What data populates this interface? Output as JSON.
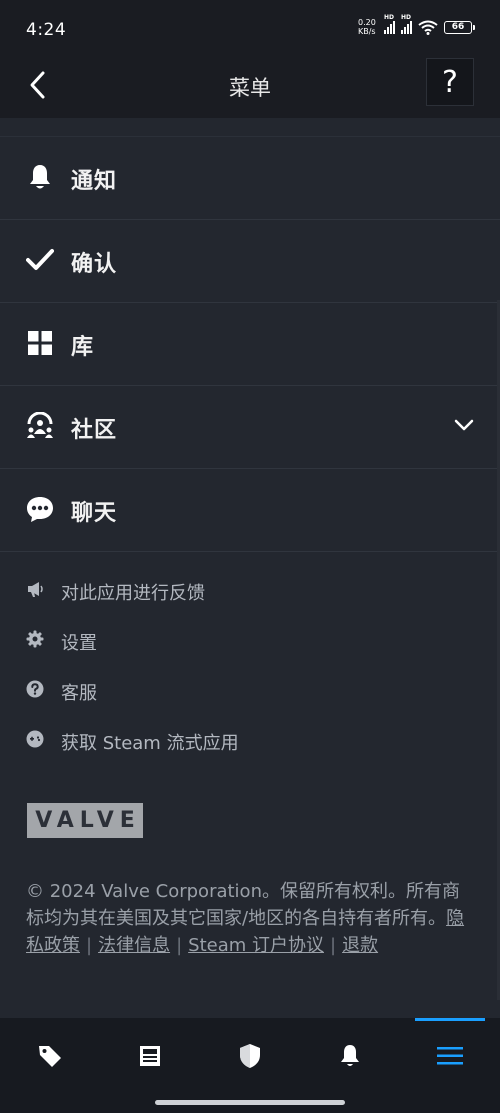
{
  "status_bar": {
    "time": "4:24",
    "net_speed_value": "0.20",
    "net_speed_unit": "KB/s",
    "signal1_label": "HD",
    "signal2_label": "HD",
    "battery": "66"
  },
  "header": {
    "title": "菜单",
    "help_label": "?"
  },
  "menu": {
    "items": [
      {
        "label": "通知",
        "icon": "bell-icon"
      },
      {
        "label": "确认",
        "icon": "checkmark-icon"
      },
      {
        "label": "库",
        "icon": "library-grid-icon"
      },
      {
        "label": "社区",
        "icon": "community-icon",
        "expandable": true
      },
      {
        "label": "聊天",
        "icon": "chat-bubble-icon"
      }
    ]
  },
  "links": {
    "items": [
      {
        "label": "对此应用进行反馈",
        "icon": "megaphone-icon"
      },
      {
        "label": "设置",
        "icon": "gear-icon"
      },
      {
        "label": "客服",
        "icon": "question-circle-icon"
      },
      {
        "label": "获取 Steam 流式应用",
        "icon": "gamepad-icon"
      }
    ]
  },
  "logo": {
    "text": "VALVE"
  },
  "legal": {
    "copyright": "© 2024 Valve Corporation。保留所有权利。所有商标均为其在美国及其它国家/地区的各自持有者所有。",
    "privacy": "隐私政策",
    "legal_info": "法律信息",
    "subscriber_agreement": "Steam 订户协议",
    "logout": "退款",
    "separator": "|"
  },
  "bottom_nav": {
    "items": [
      {
        "icon": "tag-icon",
        "name": "store"
      },
      {
        "icon": "news-icon",
        "name": "news"
      },
      {
        "icon": "shield-icon",
        "name": "guard"
      },
      {
        "icon": "bell-icon",
        "name": "notifications"
      },
      {
        "icon": "hamburger-menu-icon",
        "name": "menu",
        "active": true
      }
    ],
    "active_color": "#1a9fff"
  },
  "colors": {
    "background": "#23272f",
    "header_bg": "#1a1c22",
    "accent": "#1a9fff"
  }
}
